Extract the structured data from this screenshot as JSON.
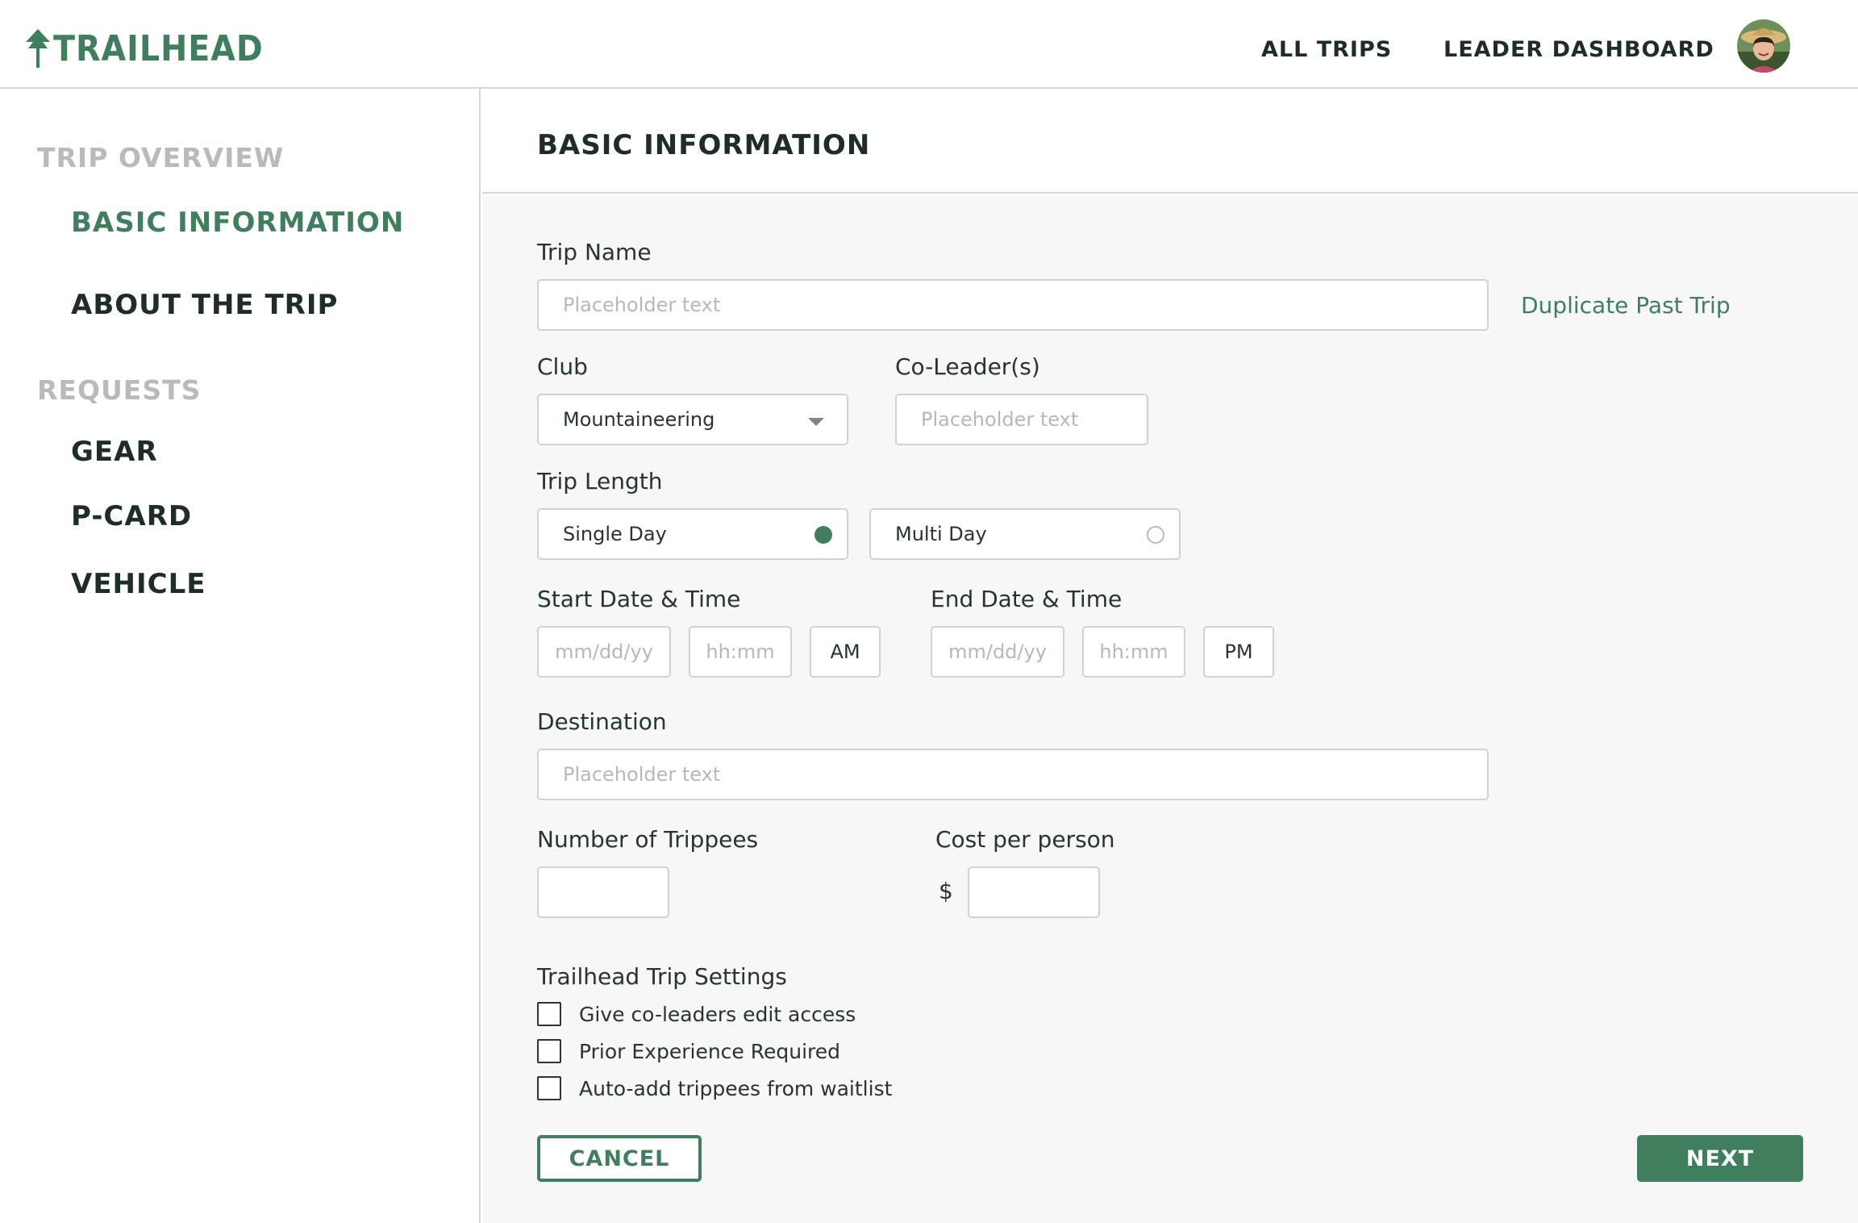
{
  "app": {
    "logo_text": "TRAILHEAD"
  },
  "header": {
    "nav": [
      {
        "label": "ALL TRIPS"
      },
      {
        "label": "LEADER DASHBOARD"
      }
    ]
  },
  "sidebar": {
    "section1": "TRIP OVERVIEW",
    "items1": [
      {
        "label": "BASIC INFORMATION",
        "active": true
      },
      {
        "label": "ABOUT THE TRIP",
        "active": false
      }
    ],
    "section2": "REQUESTS",
    "items2": [
      {
        "label": "GEAR"
      },
      {
        "label": "P-CARD"
      },
      {
        "label": "VEHICLE"
      }
    ]
  },
  "main": {
    "title": "BASIC INFORMATION"
  },
  "form": {
    "trip_name": {
      "label": "Trip Name",
      "placeholder": "Placeholder text"
    },
    "duplicate_link": "Duplicate Past Trip",
    "club": {
      "label": "Club",
      "value": "Mountaineering"
    },
    "coleaders": {
      "label": "Co-Leader(s)",
      "placeholder": "Placeholder text"
    },
    "trip_length": {
      "label": "Trip Length",
      "options": [
        {
          "label": "Single Day",
          "selected": true
        },
        {
          "label": "Multi Day",
          "selected": false
        }
      ]
    },
    "start": {
      "label": "Start Date & Time",
      "date_ph": "mm/dd/yy",
      "time_ph": "hh:mm",
      "ampm": "AM"
    },
    "end": {
      "label": "End Date & Time",
      "date_ph": "mm/dd/yy",
      "time_ph": "hh:mm",
      "ampm": "PM"
    },
    "destination": {
      "label": "Destination",
      "placeholder": "Placeholder text"
    },
    "trippees": {
      "label": "Number of Trippees",
      "value": ""
    },
    "cost": {
      "label": "Cost per person",
      "currency": "$",
      "value": ""
    },
    "settings": {
      "label": "Trailhead Trip Settings",
      "options": [
        {
          "label": "Give co-leaders edit access",
          "checked": false
        },
        {
          "label": "Prior Experience Required",
          "checked": false
        },
        {
          "label": "Auto-add trippees from waitlist",
          "checked": false
        }
      ]
    }
  },
  "actions": {
    "cancel": "CANCEL",
    "next": "NEXT"
  },
  "colors": {
    "brand_green": "#3f7f5e",
    "dark": "#1f2d27",
    "muted": "#b8bbb9",
    "panel_bg": "#f6f7f6"
  },
  "icons": {
    "logo": "pine-tree-icon",
    "dropdown": "caret-down-icon",
    "avatar": "user-avatar"
  }
}
